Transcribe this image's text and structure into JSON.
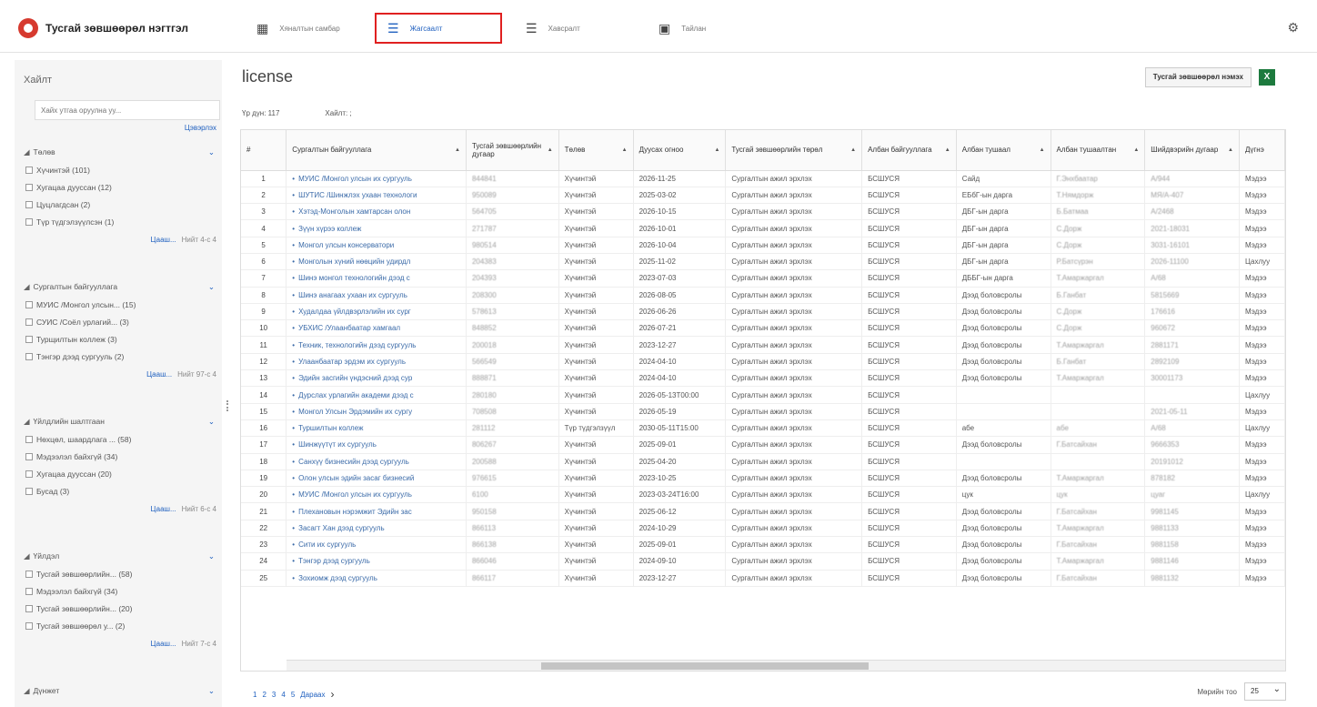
{
  "app": {
    "title": "Тусгай зөвшөөрөл нэгтгэл"
  },
  "nav": [
    {
      "label": "Хяналтын самбар",
      "icon": "dashboard-icon"
    },
    {
      "label": "Жагсаалт",
      "icon": "list-icon",
      "active": true
    },
    {
      "label": "Хавсралт",
      "icon": "attachment-list-icon"
    },
    {
      "label": "Тайлан",
      "icon": "report-icon"
    }
  ],
  "sidebar": {
    "title": "Хайлт",
    "search_placeholder": "Хайх утгаа оруулна уу...",
    "clear_label": "Цэвэрлэх",
    "facets": [
      {
        "title": "Төлөв",
        "items": [
          "Хүчинтэй (101)",
          "Хугацаа дууссан (12)",
          "Цуцлагдсан (2)",
          "Түр түдгэлзүүлсэн (1)"
        ],
        "more": "Цааш...",
        "page": "Нийт 4-с 4"
      },
      {
        "title": "Сургалтын байгууллага",
        "items": [
          "МУИС /Монгол улсын... (15)",
          "СУИС /Соёл урлагий... (3)",
          "Турщилтын коллеж (3)",
          "Тэнгэр дээд сургууль (2)"
        ],
        "more": "Цааш...",
        "page": "Нийт 97-с 4"
      },
      {
        "title": "Үйлдлийн шалтгаан",
        "items": [
          "Нөхцөл, шаардлага ... (58)",
          "Мэдээлэл байхгүй (34)",
          "Хугацаа дууссан (20)",
          "Бусад (3)"
        ],
        "more": "Цааш...",
        "page": "Нийт 6-с 4"
      },
      {
        "title": "Үйлдэл",
        "items": [
          "Тусгай зөвшөөрлийн... (58)",
          "Мэдээлэл байхгүй (34)",
          "Тусгай зөвшөөрлийн... (20)",
          "Тусгай зөвшөөрөл у... (2)"
        ],
        "more": "Цааш...",
        "page": "Нийт 7-с 4"
      },
      {
        "title": "Дүнжет",
        "items": [],
        "more": "",
        "page": ""
      }
    ]
  },
  "main": {
    "title": "license",
    "create_button": "Тусгай зөвшөөрөл нэмэх",
    "excel_label": "X",
    "record_count": "Үр дүн: 117",
    "filter_text": "Хайлт: ;"
  },
  "table": {
    "columns": [
      "#",
      "Сургалтын байгууллага",
      "Тусгай зөвшөөрлийн дугаар",
      "Төлөв",
      "Дуусах огноо",
      "Тусгай зөвшөөрлийн төрөл",
      "Албан байгууллага",
      "Албан тушаал",
      "Албан тушаалтан",
      "Шийдвэрийн дугаар",
      "Дүгнэ"
    ],
    "rows": [
      [
        "1",
        "МУИС /Монгол улсын их сургууль",
        "844841",
        "Хүчинтэй",
        "2026-11-25",
        "Сургалтын ажил эрхлэх",
        "БСШУСЯ",
        "Сайд",
        "Г.Энхбаатар",
        "А/944",
        "Мэдээ"
      ],
      [
        "2",
        "ШУТИС /Шинжлэх ухаан технологи",
        "950089",
        "Хүчинтэй",
        "2025-03-02",
        "Сургалтын ажил эрхлэх",
        "БСШУСЯ",
        "ЕБбГ-ын дарга",
        "Т.Нямдорж",
        "МЯ/А-407",
        "Мэдээ"
      ],
      [
        "3",
        "Хэтэд-Монголын хамтарсан олон",
        "564705",
        "Хүчинтэй",
        "2026-10-15",
        "Сургалтын ажил эрхлэх",
        "БСШУСЯ",
        "ДБГ-ын дарга",
        "Б.Батмаа",
        "А/2468",
        "Мэдээ"
      ],
      [
        "4",
        "Зүүн хүрээ коллеж",
        "271787",
        "Хүчинтэй",
        "2026-10-01",
        "Сургалтын ажил эрхлэх",
        "БСШУСЯ",
        "ДБГ-ын дарга",
        "С.Дорж",
        "2021-18031",
        "Мэдээ"
      ],
      [
        "5",
        "Монгол улсын консерватори",
        "980514",
        "Хүчинтэй",
        "2026-10-04",
        "Сургалтын ажил эрхлэх",
        "БСШУСЯ",
        "ДБГ-ын дарга",
        "С.Дорж",
        "3031-16101",
        "Мэдээ"
      ],
      [
        "6",
        "Монголын хүний нөөцийн удирдл",
        "204383",
        "Хүчинтэй",
        "2025-11-02",
        "Сургалтын ажил эрхлэх",
        "БСШУСЯ",
        "ДБГ-ын дарга",
        "Р.Батсүрэн",
        "2026-11100",
        "Цахлуу"
      ],
      [
        "7",
        "Шинэ монгол технологийн дээд с",
        "204393",
        "Хүчинтэй",
        "2023-07-03",
        "Сургалтын ажил эрхлэх",
        "БСШУСЯ",
        "ДББГ-ын дарга",
        "Т.Амаржаргал",
        "А/68",
        "Мэдээ"
      ],
      [
        "8",
        "Шинэ анагаах ухаан их сургууль",
        "208300",
        "Хүчинтэй",
        "2026-08-05",
        "Сургалтын ажил эрхлэх",
        "БСШУСЯ",
        "Дээд боловсролы",
        "Б.Ганбат",
        "5815669",
        "Мэдээ"
      ],
      [
        "9",
        "Худалдаа үйлдвэрлэлийн их сург",
        "578613",
        "Хүчинтэй",
        "2026-06-26",
        "Сургалтын ажил эрхлэх",
        "БСШУСЯ",
        "Дээд боловсролы",
        "С.Дорж",
        "176616",
        "Мэдээ"
      ],
      [
        "10",
        "УБХИС /Улаанбаатар хамгаал",
        "848852",
        "Хүчинтэй",
        "2026-07-21",
        "Сургалтын ажил эрхлэх",
        "БСШУСЯ",
        "Дээд боловсролы",
        "С.Дорж",
        "960672",
        "Мэдээ"
      ],
      [
        "11",
        "Техник, технологийн дээд сургууль",
        "200018",
        "Хүчинтэй",
        "2023-12-27",
        "Сургалтын ажил эрхлэх",
        "БСШУСЯ",
        "Дээд боловсролы",
        "Т.Амаржаргал",
        "2881171",
        "Мэдээ"
      ],
      [
        "12",
        "Улаанбаатар эрдэм их сургууль",
        "566549",
        "Хүчинтэй",
        "2024-04-10",
        "Сургалтын ажил эрхлэх",
        "БСШУСЯ",
        "Дээд боловсролы",
        "Б.Ганбат",
        "2892109",
        "Мэдээ"
      ],
      [
        "13",
        "Эдийн засгийн үндэсний дээд сур",
        "888871",
        "Хүчинтэй",
        "2024-04-10",
        "Сургалтын ажил эрхлэх",
        "БСШУСЯ",
        "Дээд боловсролы",
        "Т.Амаржаргал",
        "30001173",
        "Мэдээ"
      ],
      [
        "14",
        "Дурслах урлагийн академи дээд с",
        "280180",
        "Хүчинтэй",
        "2026-05-13T00:00",
        "Сургалтын ажил эрхлэх",
        "БСШУСЯ",
        "",
        "",
        "",
        "Цахлуу"
      ],
      [
        "15",
        "Монгол Улсын Эрдэмийн их сургу",
        "708508",
        "Хүчинтэй",
        "2026-05-19",
        "Сургалтын ажил эрхлэх",
        "БСШУСЯ",
        "",
        "",
        "2021-05-11",
        "Мэдээ"
      ],
      [
        "16",
        "Туршилтын коллеж",
        "281112",
        "Түр түдгэлзүүл",
        "2030-05-11T15:00",
        "Сургалтын ажил эрхлэх",
        "БСШУСЯ",
        "абе",
        "абе",
        "А/68",
        "Цахлуу"
      ],
      [
        "17",
        "Шинжүүтүт их сургууль",
        "806267",
        "Хүчинтэй",
        "2025-09-01",
        "Сургалтын ажил эрхлэх",
        "БСШУСЯ",
        "Дээд боловсролы",
        "Г.Батсайхан",
        "9666353",
        "Мэдээ"
      ],
      [
        "18",
        "Санхүү бизнесийн дээд сургууль",
        "200588",
        "Хүчинтэй",
        "2025-04-20",
        "Сургалтын ажил эрхлэх",
        "БСШУСЯ",
        "",
        "",
        "20191012",
        "Мэдээ"
      ],
      [
        "19",
        "Олон улсын эдийн засаг бизнесий",
        "976615",
        "Хүчинтэй",
        "2023-10-25",
        "Сургалтын ажил эрхлэх",
        "БСШУСЯ",
        "Дээд боловсролы",
        "Т.Амаржаргал",
        "878182",
        "Мэдээ"
      ],
      [
        "20",
        "МУИС /Монгол улсын их сургууль",
        "6100",
        "Хүчинтэй",
        "2023-03-24T16:00",
        "Сургалтын ажил эрхлэх",
        "БСШУСЯ",
        "цук",
        "цук",
        "цуаг",
        "Цахлуу"
      ],
      [
        "21",
        "Плехановын нэрэмжит Эдийн зас",
        "950158",
        "Хүчинтэй",
        "2025-06-12",
        "Сургалтын ажил эрхлэх",
        "БСШУСЯ",
        "Дээд боловсролы",
        "Г.Батсайхан",
        "9981145",
        "Мэдээ"
      ],
      [
        "22",
        "Засагт Хан дээд сургууль",
        "866113",
        "Хүчинтэй",
        "2024-10-29",
        "Сургалтын ажил эрхлэх",
        "БСШУСЯ",
        "Дээд боловсролы",
        "Т.Амаржаргал",
        "9881133",
        "Мэдээ"
      ],
      [
        "23",
        "Сити их сургууль",
        "866138",
        "Хүчинтэй",
        "2025-09-01",
        "Сургалтын ажил эрхлэх",
        "БСШУСЯ",
        "Дээд боловсролы",
        "Г.Батсайхан",
        "9881158",
        "Мэдээ"
      ],
      [
        "24",
        "Тэнгэр дээд сургууль",
        "866046",
        "Хүчинтэй",
        "2024-09-10",
        "Сургалтын ажил эрхлэх",
        "БСШУСЯ",
        "Дээд боловсролы",
        "Т.Амаржаргал",
        "9881146",
        "Мэдээ"
      ],
      [
        "25",
        "Зохиомж дээд сургууль",
        "866117",
        "Хүчинтэй",
        "2023-12-27",
        "Сургалтын ажил эрхлэх",
        "БСШУСЯ",
        "Дээд боловсролы",
        "Г.Батсайхан",
        "9881132",
        "Мэдээ"
      ]
    ]
  },
  "pager": {
    "pages": [
      "1",
      "2",
      "3",
      "4",
      "5"
    ],
    "next": "Дараах"
  },
  "rows_per_page": {
    "label": "Мөрийн тоо",
    "value": "25"
  }
}
